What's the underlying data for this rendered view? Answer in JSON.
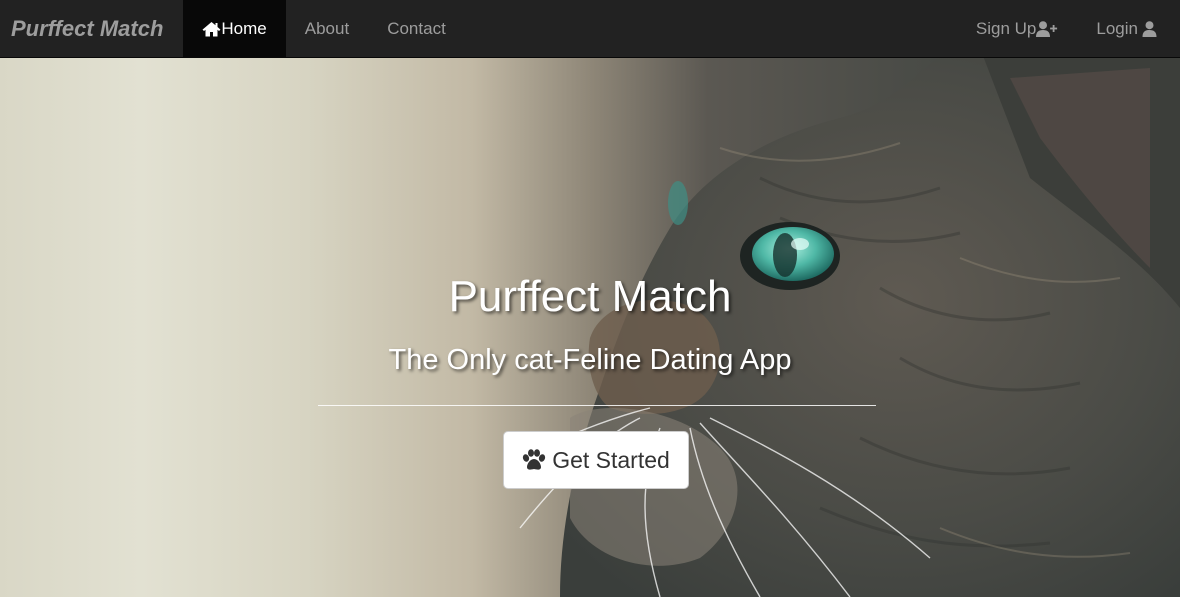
{
  "navbar": {
    "brand": "Purffect Match",
    "items": [
      {
        "label": "Home",
        "icon": "home-icon",
        "active": true
      },
      {
        "label": "About"
      },
      {
        "label": "Contact"
      }
    ],
    "right_items": [
      {
        "label": "Sign Up",
        "icon": "user-plus-icon"
      },
      {
        "label": "Login",
        "icon": "user-icon"
      }
    ]
  },
  "hero": {
    "title": "Purffect Match",
    "subtitle": "The Only cat-Feline Dating App",
    "cta_label": "Get Started",
    "cta_icon": "paw-icon",
    "background": "cat-photo"
  },
  "colors": {
    "navbar_bg": "#222222",
    "nav_text": "#9d9d9d",
    "active_bg": "#080808",
    "cat_eye": "#4fb8a6"
  }
}
